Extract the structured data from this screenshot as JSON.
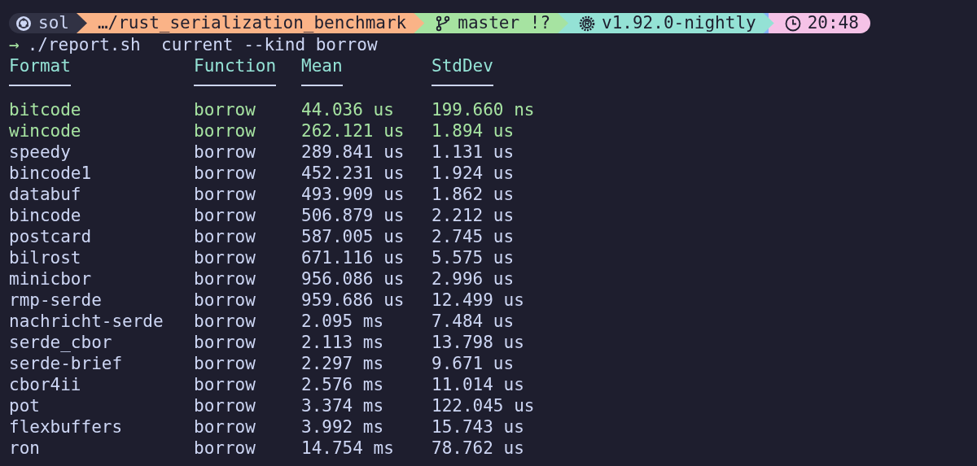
{
  "prompt": {
    "segments": [
      {
        "kind": "host",
        "text": "sol",
        "color": "#313244"
      },
      {
        "kind": "path",
        "text": "…/rust_serialization_benchmark",
        "color": "#fab387"
      },
      {
        "kind": "git",
        "text": "master !?",
        "color": "#a6e3a1"
      },
      {
        "kind": "rust",
        "text": "v1.92.0-nightly",
        "color": "#94e2d5"
      },
      {
        "kind": "time",
        "text": "20:48",
        "color": "#f5c2e7"
      }
    ]
  },
  "command": {
    "prompt_symbol": "→",
    "text": "./report.sh  current --kind borrow"
  },
  "table": {
    "columns": [
      "Format",
      "Function",
      "Mean",
      "StdDev"
    ],
    "rows": [
      {
        "cells": [
          "bitcode",
          "borrow",
          "44.036 us",
          "199.660 ns"
        ],
        "highlighted": true
      },
      {
        "cells": [
          "wincode",
          "borrow",
          "262.121 us",
          "1.894 us"
        ],
        "highlighted": true
      },
      {
        "cells": [
          "speedy",
          "borrow",
          "289.841 us",
          "1.131 us"
        ],
        "highlighted": false
      },
      {
        "cells": [
          "bincode1",
          "borrow",
          "452.231 us",
          "1.924 us"
        ],
        "highlighted": false
      },
      {
        "cells": [
          "databuf",
          "borrow",
          "493.909 us",
          "1.862 us"
        ],
        "highlighted": false
      },
      {
        "cells": [
          "bincode",
          "borrow",
          "506.879 us",
          "2.212 us"
        ],
        "highlighted": false
      },
      {
        "cells": [
          "postcard",
          "borrow",
          "587.005 us",
          "2.745 us"
        ],
        "highlighted": false
      },
      {
        "cells": [
          "bilrost",
          "borrow",
          "671.116 us",
          "5.575 us"
        ],
        "highlighted": false
      },
      {
        "cells": [
          "minicbor",
          "borrow",
          "956.086 us",
          "2.996 us"
        ],
        "highlighted": false
      },
      {
        "cells": [
          "rmp-serde",
          "borrow",
          "959.686 us",
          "12.499 us"
        ],
        "highlighted": false
      },
      {
        "cells": [
          "nachricht-serde",
          "borrow",
          "2.095 ms",
          "7.484 us"
        ],
        "highlighted": false
      },
      {
        "cells": [
          "serde_cbor",
          "borrow",
          "2.113 ms",
          "13.798 us"
        ],
        "highlighted": false
      },
      {
        "cells": [
          "serde-brief",
          "borrow",
          "2.297 ms",
          "9.671 us"
        ],
        "highlighted": false
      },
      {
        "cells": [
          "cbor4ii",
          "borrow",
          "2.576 ms",
          "11.014 us"
        ],
        "highlighted": false
      },
      {
        "cells": [
          "pot",
          "borrow",
          "3.374 ms",
          "122.045 us"
        ],
        "highlighted": false
      },
      {
        "cells": [
          "flexbuffers",
          "borrow",
          "3.992 ms",
          "15.743 us"
        ],
        "highlighted": false
      },
      {
        "cells": [
          "ron",
          "borrow",
          "14.754 ms",
          "78.762 us"
        ],
        "highlighted": false
      }
    ]
  }
}
